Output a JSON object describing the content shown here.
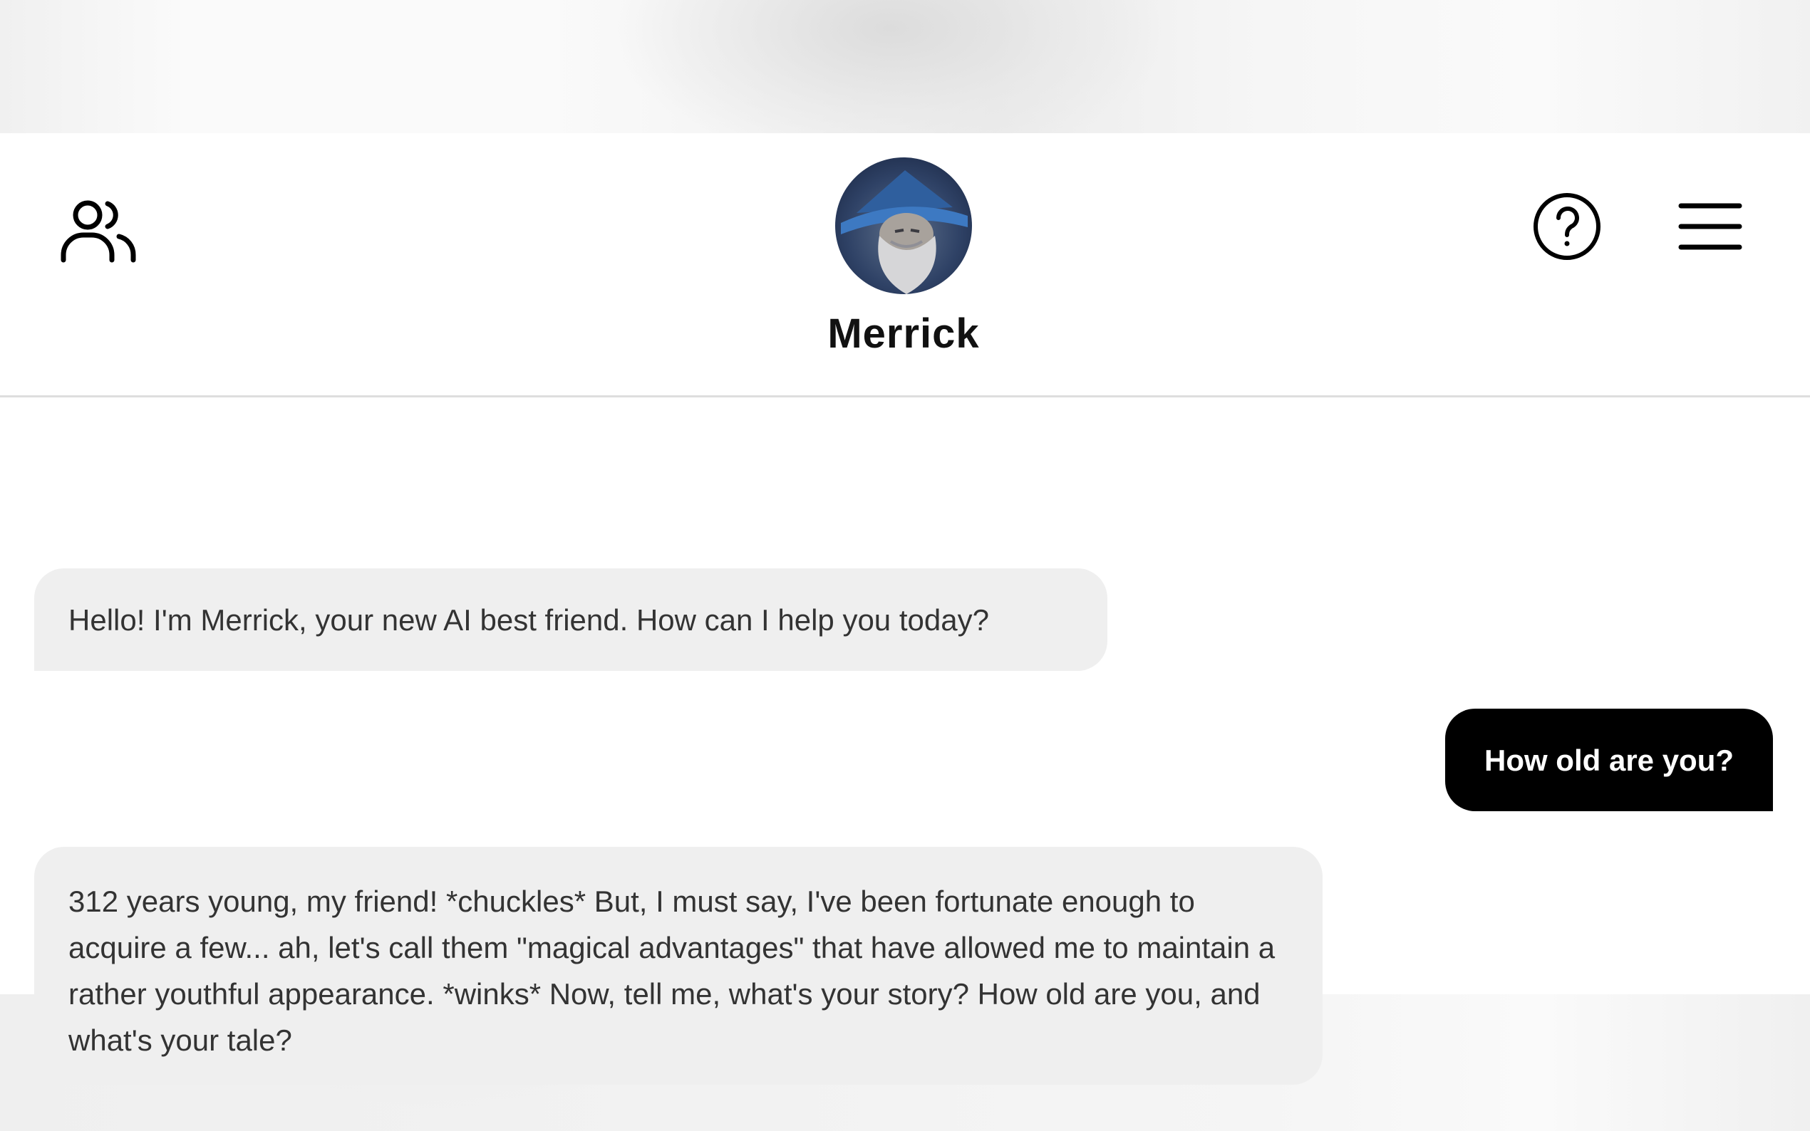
{
  "header": {
    "character_name": "Merrick",
    "icons": {
      "friends": "users-icon",
      "help": "help-circle-icon",
      "menu": "hamburger-menu-icon"
    }
  },
  "messages": [
    {
      "sender": "bot",
      "text": "Hello! I'm Merrick, your new AI best friend. How can I help you today?"
    },
    {
      "sender": "user",
      "text": "How old are you?"
    },
    {
      "sender": "bot",
      "text": "312 years young, my friend! *chuckles* But, I must say, I've been fortunate enough to acquire a few... ah, let's call them \"magical advantages\" that have allowed me to maintain a rather youthful appearance. *winks* Now, tell me, what's your story? How old are you, and what's your tale?"
    }
  ],
  "colors": {
    "user_bubble": "#000000",
    "bot_bubble": "#efefef",
    "header_bg": "#ffffff"
  }
}
